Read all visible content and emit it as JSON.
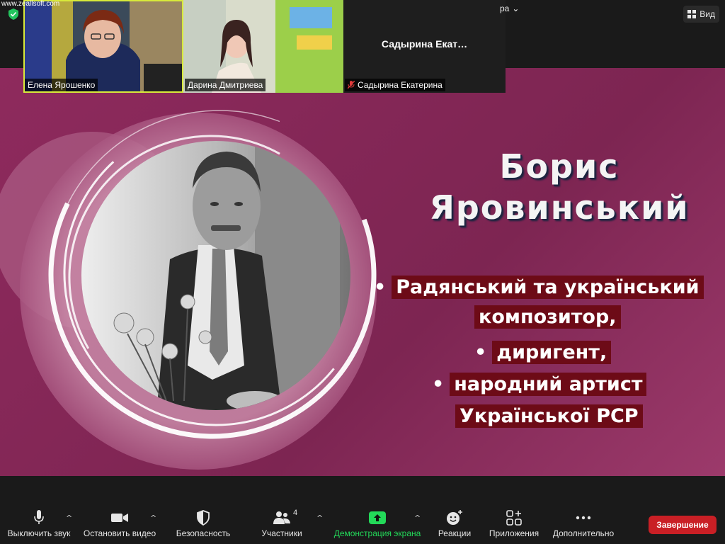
{
  "watermark": "www.zeallsoft.com",
  "meeting": {
    "view_label": "Вид",
    "camera_label": "ра"
  },
  "participants": [
    {
      "name": "Елена Ярошенко",
      "active": true
    },
    {
      "name": "Дарина Дмитриева",
      "active": false
    },
    {
      "name": "Садырина Екатерина",
      "display_name": "Садырина  Екат…",
      "muted": true
    }
  ],
  "slide": {
    "title_line1": "Борис",
    "title_line2": "Яровинський",
    "bullet1_line1": "Радянський та український",
    "bullet1_line2": "композитор,",
    "bullet2": "диригент,",
    "bullet3_line1": "народний артист",
    "bullet3_line2": "Української РСР"
  },
  "toolbar": {
    "mute": "Выключить звук",
    "video": "Остановить видео",
    "security": "Безопасность",
    "participants": "Участники",
    "participants_count": "4",
    "share": "Демонстрация экрана",
    "reactions": "Реакции",
    "apps": "Приложения",
    "more": "Дополнительно",
    "end": "Завершение"
  },
  "colors": {
    "slide_bg": "#8e2a5d",
    "highlight": "#6d0b17",
    "share_green": "#23d959",
    "end_red": "#c91f25",
    "active_speaker": "#d8ea3a"
  }
}
